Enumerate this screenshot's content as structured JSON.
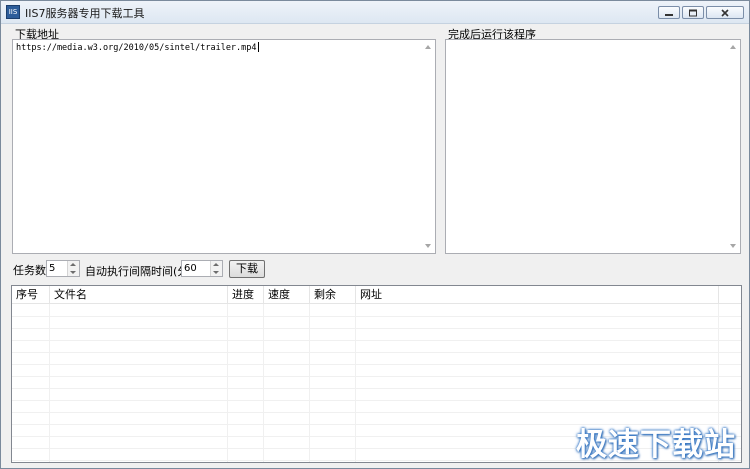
{
  "window": {
    "title": "IIS7服务器专用下载工具",
    "icon_text": "IIS"
  },
  "download_panel": {
    "label": "下载地址",
    "url_value": "https://media.w3.org/2010/05/sintel/trailer.mp4"
  },
  "after_panel": {
    "label": "完成后运行该程序",
    "value": ""
  },
  "controls": {
    "task_label": "任务数",
    "task_value": "5",
    "interval_label": "自动执行间隔时间(分)",
    "interval_value": "60",
    "download_button": "下载"
  },
  "table": {
    "columns": [
      "序号",
      "文件名",
      "进度",
      "速度",
      "剩余",
      "网址"
    ],
    "rows": []
  },
  "watermark": "极速下载站"
}
